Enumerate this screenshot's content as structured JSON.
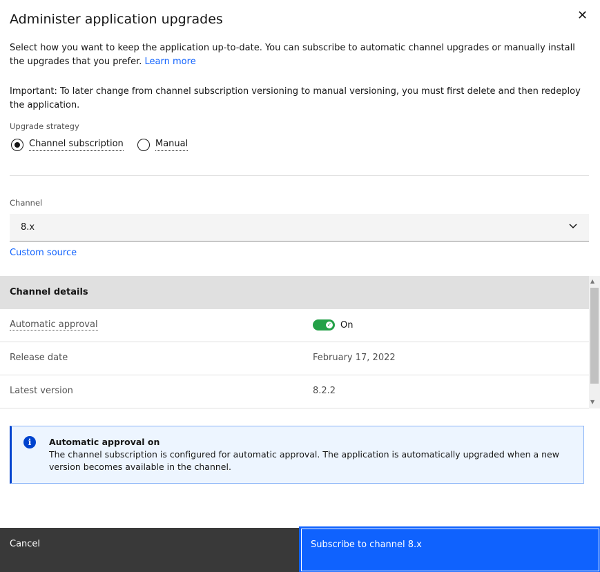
{
  "dialog": {
    "title": "Administer application upgrades",
    "close_icon": "close-icon"
  },
  "intro": {
    "text": "Select how you want to keep the application up-to-date. You can subscribe to automatic channel upgrades or manually install the upgrades that you prefer.",
    "link": "Learn more"
  },
  "important": "Important: To later change from channel subscription versioning to manual versioning, you must first delete and then redeploy the application.",
  "strategy": {
    "label": "Upgrade strategy",
    "options": [
      {
        "label": "Channel subscription",
        "selected": true
      },
      {
        "label": "Manual",
        "selected": false
      }
    ]
  },
  "channel": {
    "label": "Channel",
    "value": "8.x",
    "custom_source": "Custom source"
  },
  "details": {
    "header": "Channel details",
    "rows": [
      {
        "key": "Automatic approval",
        "value": "On",
        "toggle_on": true
      },
      {
        "key": "Release date",
        "value": "February 17, 2022"
      },
      {
        "key": "Latest version",
        "value": "8.2.2"
      }
    ]
  },
  "notification": {
    "title": "Automatic approval on",
    "body": "The channel subscription is configured for automatic approval. The application is automatically upgraded when a new version becomes available in the channel.",
    "icon": "info-icon"
  },
  "footer": {
    "cancel": "Cancel",
    "subscribe": "Subscribe to channel 8.x"
  },
  "colors": {
    "primary": "#0f62fe",
    "toggle_on": "#24a148",
    "footer_secondary": "#393939"
  }
}
